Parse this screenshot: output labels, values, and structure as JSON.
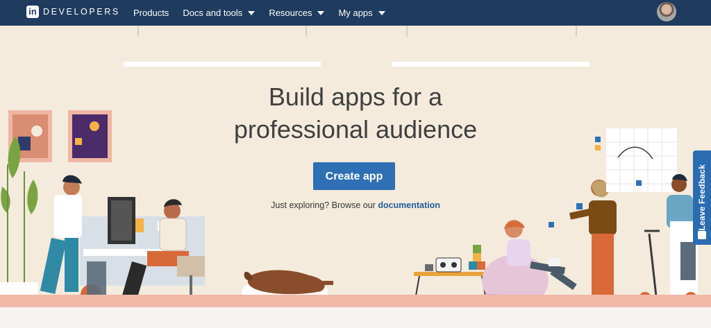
{
  "nav": {
    "brand_text": "DEVELOPERS",
    "brand_mark": "in",
    "items": [
      {
        "label": "Products",
        "has_caret": false
      },
      {
        "label": "Docs and tools",
        "has_caret": true
      },
      {
        "label": "Resources",
        "has_caret": true
      },
      {
        "label": "My apps",
        "has_caret": true
      }
    ]
  },
  "hero": {
    "title_line1": "Build apps for a",
    "title_line2": "professional audience",
    "cta_label": "Create app",
    "explore_prefix": "Just exploring? Browse our",
    "explore_link": "documentation"
  },
  "feedback": {
    "label": "Leave Feedback"
  },
  "colors": {
    "nav_bg": "#1f3b5e",
    "hero_bg": "#f4ebdd",
    "accent": "#2f6fb3",
    "floor": "#f1b8a7"
  }
}
